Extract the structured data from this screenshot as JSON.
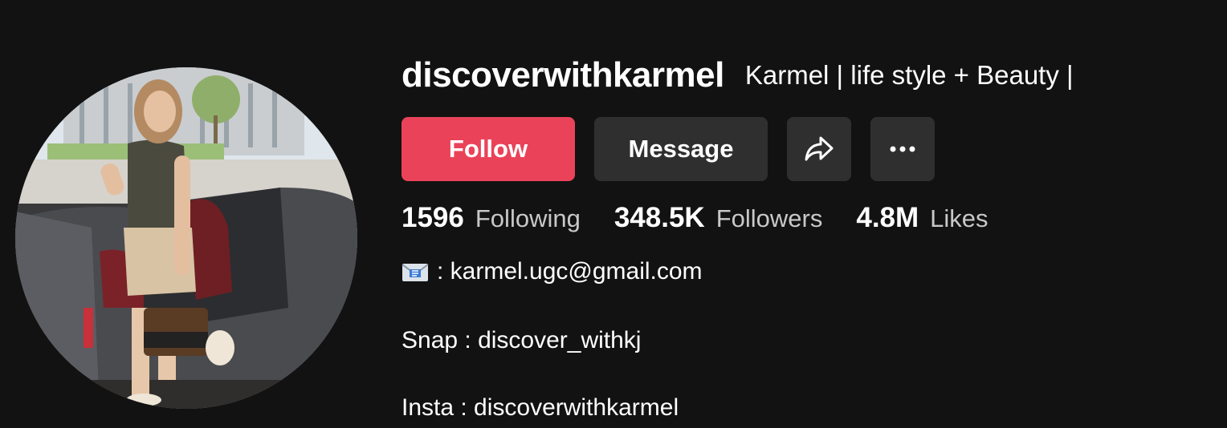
{
  "profile": {
    "username": "discoverwithkarmel",
    "display_name": "Karmel | life style + Beauty |"
  },
  "actions": {
    "follow_label": "Follow",
    "message_label": "Message",
    "share_icon": "share-arrow-icon",
    "more_icon": "more-dots-icon"
  },
  "stats": {
    "following": {
      "value": "1596",
      "label": "Following"
    },
    "followers": {
      "value": "348.5K",
      "label": "Followers"
    },
    "likes": {
      "value": "4.8M",
      "label": "Likes"
    }
  },
  "bio": {
    "email_icon": "envelope-icon",
    "line1": ": karmel.ugc@gmail.com",
    "line2": "Snap : discover_withkj",
    "line3": "Insta : discoverwithkarmel"
  },
  "colors": {
    "background": "#121212",
    "follow_button": "#ea4359",
    "secondary_button": "#2f2f2f",
    "muted_text": "#c8c8c8"
  }
}
